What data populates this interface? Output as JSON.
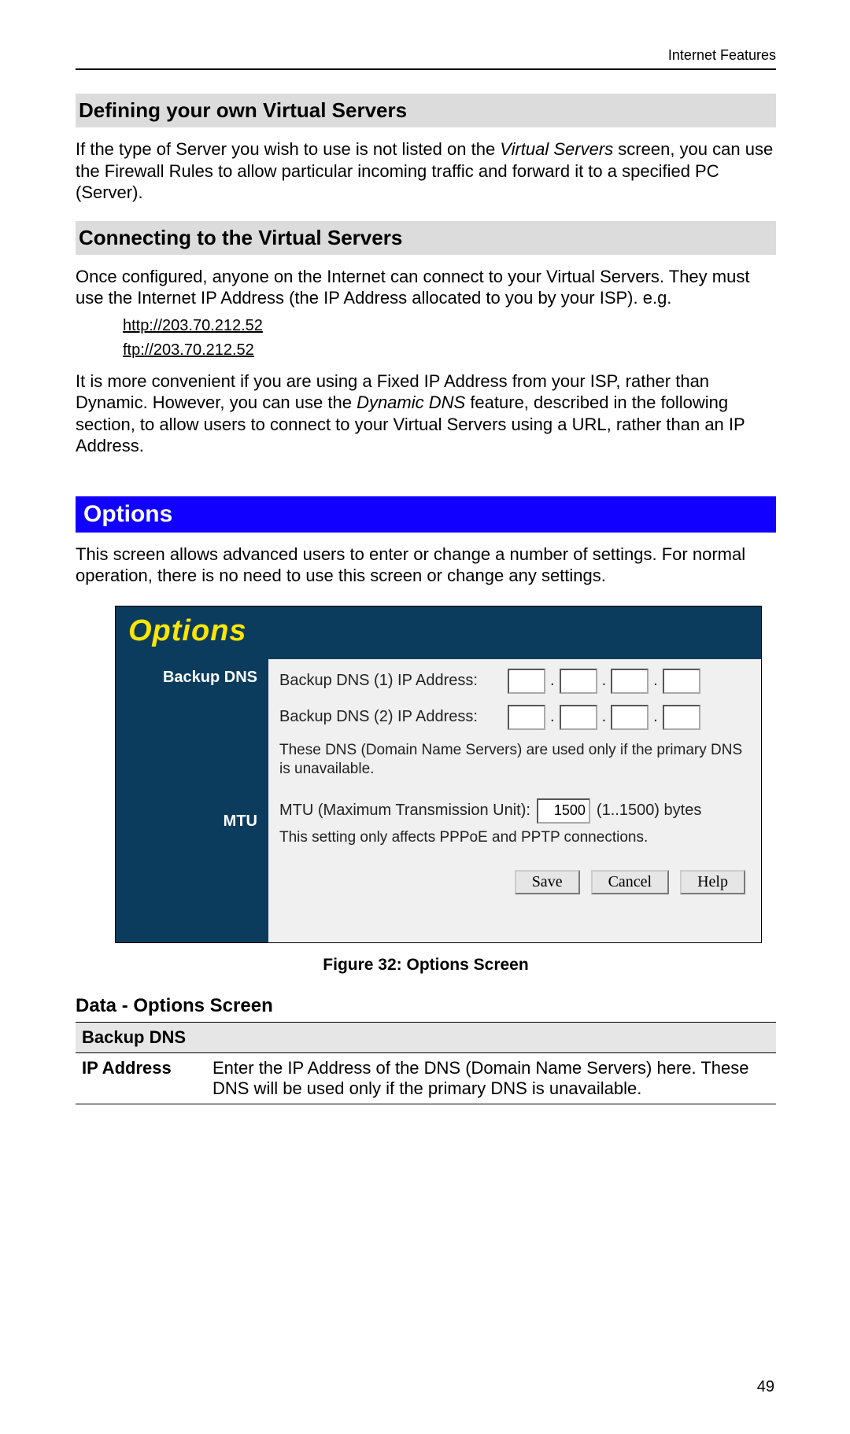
{
  "header": {
    "label": "Internet Features"
  },
  "section1": {
    "title": "Defining your own Virtual Servers",
    "body_a": "If the type of Server you wish to use is not listed on the ",
    "body_italic": "Virtual Servers",
    "body_b": " screen, you can use the Firewall Rules to allow particular incoming traffic and forward it to a specified PC (Server)."
  },
  "section2": {
    "title": "Connecting to the Virtual Servers",
    "body1": "Once configured, anyone on the Internet can connect to your Virtual Servers. They must use the Internet IP Address (the IP Address allocated to you by your ISP). e.g.",
    "url1": "http://203.70.212.52",
    "url2": "ftp://203.70.212.52",
    "body2_a": "It is more convenient if you are using a Fixed IP Address from your ISP, rather than Dynamic.  However, you can use the ",
    "body2_italic": "Dynamic DNS",
    "body2_b": " feature, described in the following section, to allow users to connect to your Virtual Servers using a URL, rather than an IP Address."
  },
  "options": {
    "heading": "Options",
    "intro": "This screen allows advanced users to enter or change a number of settings. For normal operation, there is no need to use this screen or change any settings.",
    "panel": {
      "title": "Options",
      "left_backup": "Backup DNS",
      "left_mtu": "MTU",
      "dns1_label": "Backup DNS (1) IP Address:",
      "dns2_label": "Backup DNS (2) IP Address:",
      "dns_note": "These DNS (Domain Name Servers) are used only if the primary DNS is unavailable.",
      "mtu_label": "MTU (Maximum Transmission Unit):",
      "mtu_value": "1500",
      "mtu_hint": "(1..1500) bytes",
      "mtu_note": "This setting only affects PPPoE and PPTP connections.",
      "btn_save": "Save",
      "btn_cancel": "Cancel",
      "btn_help": "Help"
    },
    "caption": "Figure 32: Options Screen"
  },
  "data_table": {
    "heading": "Data - Options Screen",
    "section": "Backup DNS",
    "row_key": "IP Address",
    "row_val": "Enter the IP Address of the DNS (Domain Name Servers) here. These DNS will be used only if the primary DNS is unavailable."
  },
  "page_number": "49"
}
